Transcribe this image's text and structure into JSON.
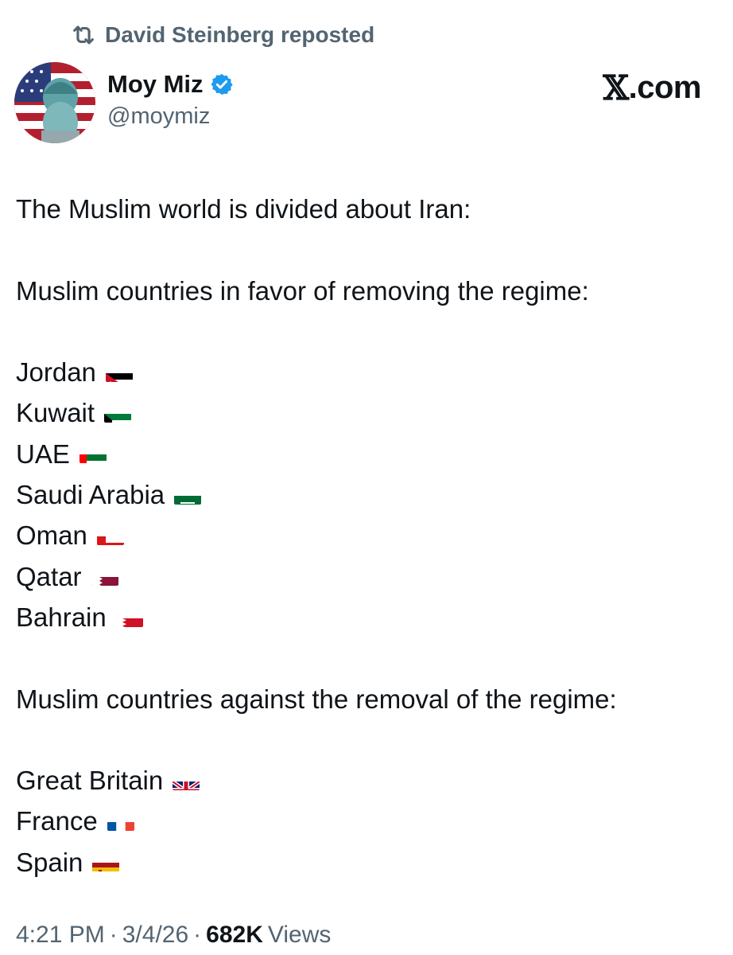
{
  "repost": {
    "icon": "repost-icon",
    "text": "David Steinberg reposted"
  },
  "author": {
    "display_name": "Moy Miz",
    "handle": "@moymiz",
    "verified_icon": "verified-badge-icon",
    "verified_color": "#1d9bf0"
  },
  "brand": {
    "logo": "𝕏",
    "suffix": ".com"
  },
  "post": {
    "intro": "The Muslim world is divided about Iran:",
    "favor_heading": "Muslim countries in favor of removing the regime:",
    "favor": [
      {
        "name": "Jordan",
        "flag": "jordan-flag-icon"
      },
      {
        "name": "Kuwait",
        "flag": "kuwait-flag-icon"
      },
      {
        "name": "UAE",
        "flag": "uae-flag-icon"
      },
      {
        "name": "Saudi Arabia",
        "flag": "saudi-arabia-flag-icon"
      },
      {
        "name": "Oman",
        "flag": "oman-flag-icon"
      },
      {
        "name": "Qatar",
        "flag": "qatar-flag-icon"
      },
      {
        "name": "Bahrain",
        "flag": "bahrain-flag-icon"
      }
    ],
    "against_heading": "Muslim countries against the removal of the regime:",
    "against": [
      {
        "name": "Great Britain",
        "flag": "uk-flag-icon"
      },
      {
        "name": "France",
        "flag": "france-flag-icon"
      },
      {
        "name": "Spain",
        "flag": "spain-flag-icon"
      }
    ]
  },
  "meta": {
    "time": "4:21 PM",
    "sep": "·",
    "date": "3/4/26",
    "views_count": "682K",
    "views_label": "Views"
  },
  "colors": {
    "text": "#0f1419",
    "secondary": "#536471"
  }
}
